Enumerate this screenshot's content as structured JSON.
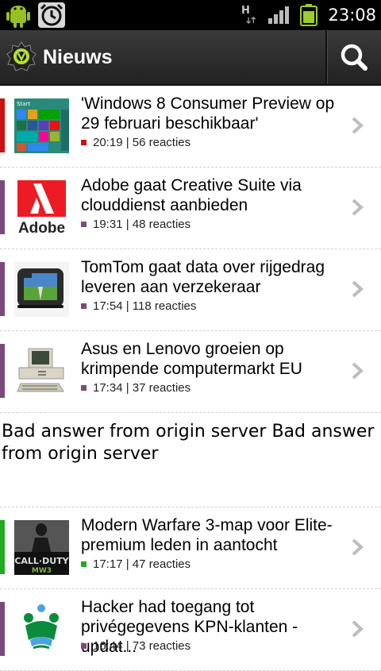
{
  "status_bar": {
    "time": "23:08",
    "network_label": "H",
    "icons": [
      "android-icon",
      "alarm-icon",
      "hspa-icon",
      "signal-icon",
      "battery-icon"
    ]
  },
  "action_bar": {
    "title": "Nieuws",
    "logo_icon": "tweakers-logo-icon",
    "search_icon": "search-icon"
  },
  "articles": [
    {
      "title": "'Windows 8 Consumer Preview op 29 februari beschikbaar'",
      "time": "20:19",
      "reactions": "56 reacties",
      "meta": "20:19 | 56 reacties",
      "accent_color": "#cc1111",
      "thumb_icon": "windows8-start-thumbnail"
    },
    {
      "title": "Adobe gaat Creative Suite via clouddienst aanbieden",
      "time": "19:31",
      "reactions": "48 reacties",
      "meta": "19:31 | 48 reacties",
      "accent_color": "#7b4a7b",
      "thumb_icon": "adobe-logo-thumbnail",
      "thumb_text": "Adobe"
    },
    {
      "title": "TomTom gaat data over rijgedrag leveren aan verzekeraar",
      "time": "17:54",
      "reactions": "118 reacties",
      "meta": "17:54 | 118 reacties",
      "accent_color": "#7b4a7b",
      "thumb_icon": "tomtom-device-thumbnail"
    },
    {
      "title": "Asus en Lenovo groeien op krimpende computermarkt EU",
      "time": "17:34",
      "reactions": "37 reacties",
      "meta": "17:34 | 37 reacties",
      "accent_color": "#7b4a7b",
      "thumb_icon": "vintage-pc-thumbnail"
    },
    {
      "title": "Modern Warfare 3-map voor Elite-premium leden in aantocht",
      "time": "17:17",
      "reactions": "47 reacties",
      "meta": "17:17 | 47 reacties",
      "accent_color": "#22aa22",
      "thumb_icon": "call-of-duty-mw3-thumbnail",
      "thumb_text": "CALL·DUTY MW3"
    },
    {
      "title": "Hacker had toegang tot privégegevens KPN-klanten - updat...",
      "time": "16:44",
      "reactions": "73 reacties",
      "meta": "16:44 | 73 reacties",
      "accent_color": "#7b4a7b",
      "thumb_icon": "kpn-crown-logo-thumbnail"
    }
  ],
  "error_message": "Bad answer from origin server Bad answer from origin server",
  "colors": {
    "status_bar": "#000000",
    "action_bar": "#2b2b2b",
    "accent_red": "#cc1111",
    "accent_purple": "#7b4a7b",
    "accent_green": "#22aa22"
  }
}
